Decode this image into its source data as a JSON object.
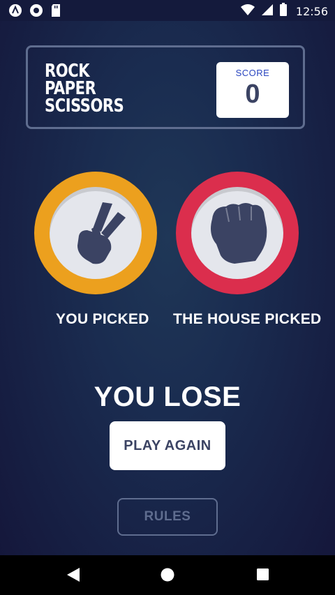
{
  "status_bar": {
    "time": "12:56",
    "left_icons": [
      "android-auto-icon",
      "circle-notification-icon",
      "sd-card-icon"
    ],
    "right_icons": [
      "wifi-icon",
      "signal-icon",
      "battery-icon"
    ]
  },
  "header": {
    "title_lines": [
      "ROCK",
      "PAPER",
      "SCISSORS"
    ],
    "score_label": "SCORE",
    "score_value": "0"
  },
  "game": {
    "player_pick": {
      "label": "YOU PICKED",
      "choice_icon": "scissors-icon",
      "ring_color": "#eca01e"
    },
    "house_pick": {
      "label": "THE HOUSE PICKED",
      "choice_icon": "rock-icon",
      "ring_color": "#db2e4d"
    },
    "result": "YOU LOSE",
    "play_again_label": "PLAY AGAIN"
  },
  "footer": {
    "rules_label": "RULES"
  },
  "nav_bar": {
    "icons": [
      "back-icon",
      "home-icon",
      "recents-icon"
    ]
  },
  "colors": {
    "background": "#1f3757",
    "text_dark": "#3b4363",
    "outline": "#5f6d8f",
    "score_label": "#2a46c0"
  }
}
